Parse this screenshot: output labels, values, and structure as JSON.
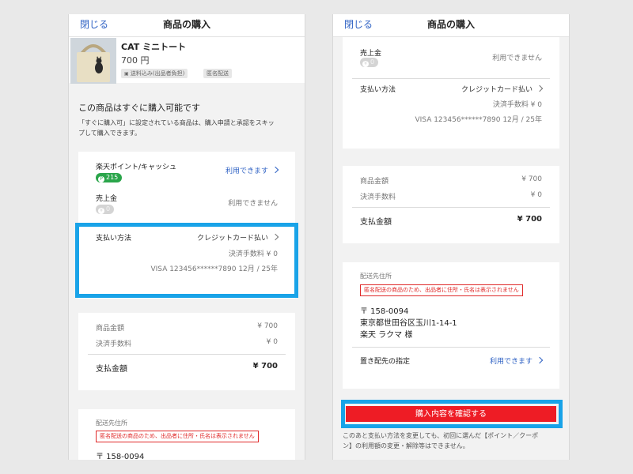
{
  "header": {
    "close_label": "閉じる",
    "title": "商品の購入"
  },
  "product": {
    "name": "CAT ミニトート",
    "price": "700 円",
    "tags": [
      "送料込み(出品者負担)",
      "匿名配送"
    ]
  },
  "instant": {
    "title": "この商品はすぐに購入可能です",
    "desc_line1": "「すぐに購入可」に設定されている商品は、購入申請と承認をスキッ",
    "desc_line2": "プして購入できます。"
  },
  "points": {
    "label": "楽天ポイント/キャッシュ",
    "badge": "215",
    "status": "利用できます"
  },
  "sales": {
    "label": "売上金",
    "badge": "0",
    "status": "利用できません"
  },
  "payment": {
    "label": "支払い方法",
    "method": "クレジットカード払い",
    "fee": "決済手数料 ¥ 0",
    "card": "VISA 123456******7890 12月 / 25年"
  },
  "summary": {
    "item_label": "商品金額",
    "item_value": "¥ 700",
    "fee_label": "決済手数料",
    "fee_value": "¥ 0",
    "total_label": "支払金額",
    "total_value": "¥ 700"
  },
  "shipping": {
    "label": "配送先住所",
    "warning": "匿名配送の商品のため、出品者に住所・氏名は表示されません",
    "zip": "〒 158-0094",
    "address": "東京都世田谷区玉川1-14-1",
    "name": "楽天 ラクマ 様"
  },
  "dropoff": {
    "label": "置き配先の指定",
    "status": "利用できます"
  },
  "confirm": {
    "label": "購入内容を確認する"
  },
  "notice": {
    "line1": "このあと支払い方法を変更しても、初回に選んだ【ポイント／クーポ",
    "line2": "ン】の利用額の変更・解除等はできません。"
  },
  "colors": {
    "link_blue": "#2f62c4",
    "confirm_red": "#ee1c25",
    "highlight_blue": "#19a3e8",
    "badge_green": "#2aa54a"
  }
}
